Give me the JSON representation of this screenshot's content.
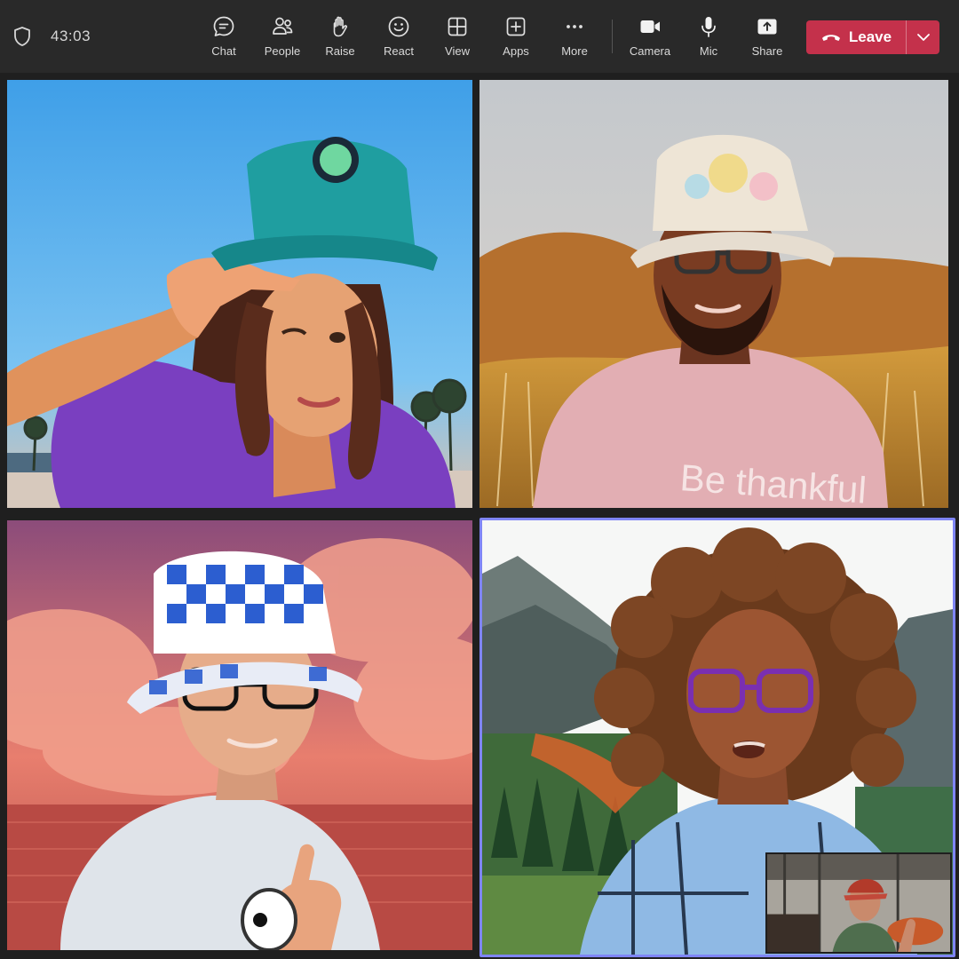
{
  "call": {
    "timer": "43:03",
    "security_icon": "shield-icon"
  },
  "toolbar": {
    "items": [
      {
        "id": "chat",
        "label": "Chat",
        "icon": "chat-icon"
      },
      {
        "id": "people",
        "label": "People",
        "icon": "people-icon"
      },
      {
        "id": "raise",
        "label": "Raise",
        "icon": "raise-hand-icon"
      },
      {
        "id": "react",
        "label": "React",
        "icon": "smiley-icon"
      },
      {
        "id": "view",
        "label": "View",
        "icon": "grid-icon"
      },
      {
        "id": "apps",
        "label": "Apps",
        "icon": "plus-square-icon"
      },
      {
        "id": "more",
        "label": "More",
        "icon": "ellipsis-icon"
      },
      {
        "id": "camera",
        "label": "Camera",
        "icon": "camera-icon"
      },
      {
        "id": "mic",
        "label": "Mic",
        "icon": "mic-icon"
      },
      {
        "id": "share",
        "label": "Share",
        "icon": "share-icon"
      }
    ],
    "leave_label": "Leave",
    "leave_color": "#c4314b"
  },
  "tiles": [
    {
      "id": "tile1",
      "scene": "beach",
      "tshirt_text": ""
    },
    {
      "id": "tile2",
      "scene": "golden-hills",
      "tshirt_text": "Be thankful"
    },
    {
      "id": "tile3",
      "scene": "pink-clouds-sea",
      "tshirt_text": ""
    },
    {
      "id": "tile4",
      "scene": "mountain-forest",
      "tshirt_text": "",
      "active_speaker": true,
      "highlight_color": "#7f85f5"
    }
  ]
}
